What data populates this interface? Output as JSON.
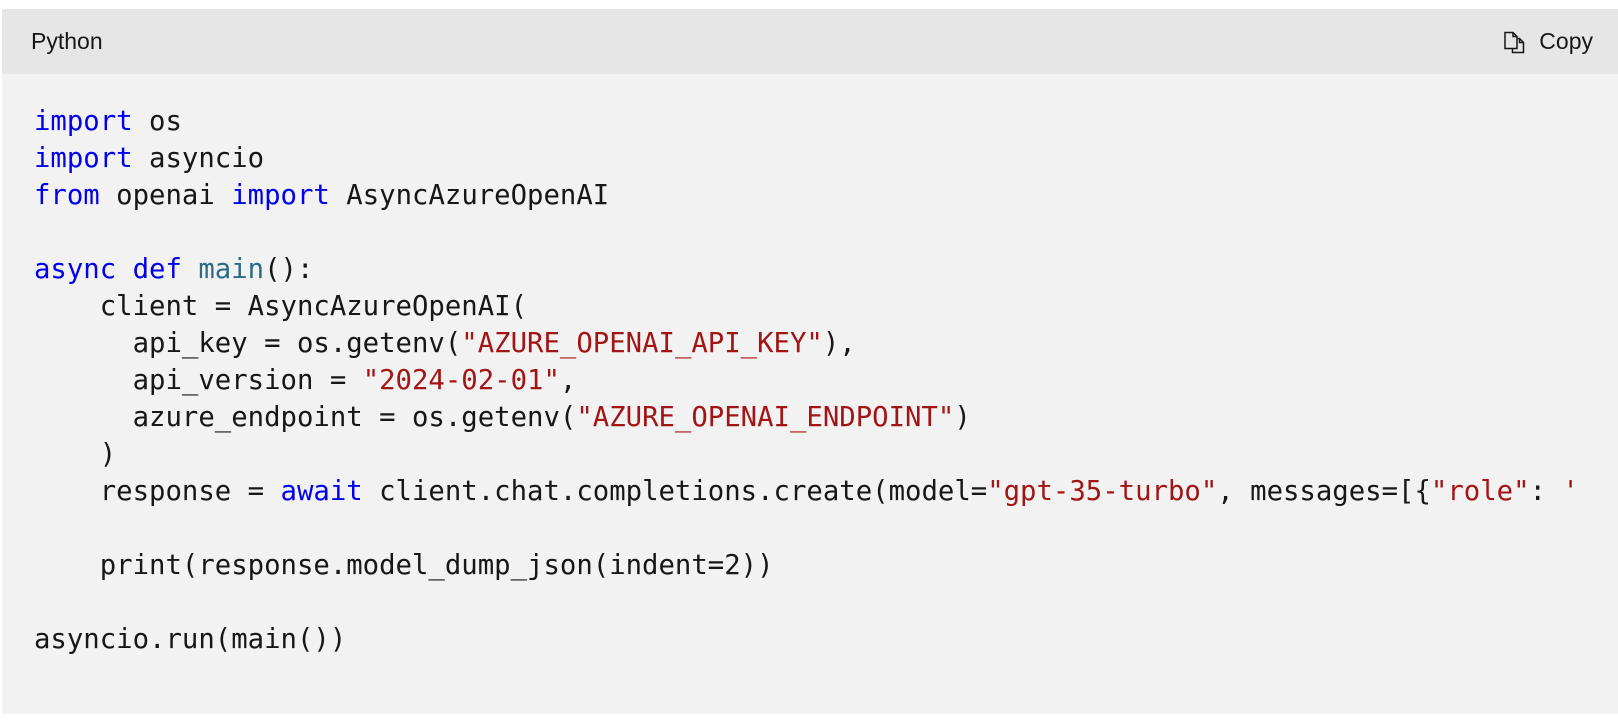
{
  "header": {
    "language": "Python",
    "copy_label": "Copy",
    "copy_icon": "copy-icon"
  },
  "colors": {
    "keyword": "#0000ee",
    "function": "#2c6b85",
    "string": "#a31515",
    "text": "#171717",
    "background": "#f2f2f2",
    "header_background": "#e6e6e6"
  },
  "code": {
    "lines": [
      [
        {
          "t": "kw",
          "v": "import"
        },
        {
          "t": "txt",
          "v": " os"
        }
      ],
      [
        {
          "t": "kw",
          "v": "import"
        },
        {
          "t": "txt",
          "v": " asyncio"
        }
      ],
      [
        {
          "t": "kw",
          "v": "from"
        },
        {
          "t": "txt",
          "v": " openai "
        },
        {
          "t": "kw",
          "v": "import"
        },
        {
          "t": "txt",
          "v": " AsyncAzureOpenAI"
        }
      ],
      [],
      [
        {
          "t": "kw",
          "v": "async"
        },
        {
          "t": "txt",
          "v": " "
        },
        {
          "t": "kw",
          "v": "def"
        },
        {
          "t": "txt",
          "v": " "
        },
        {
          "t": "fn",
          "v": "main"
        },
        {
          "t": "txt",
          "v": "():"
        }
      ],
      [
        {
          "t": "txt",
          "v": "    client = AsyncAzureOpenAI("
        }
      ],
      [
        {
          "t": "txt",
          "v": "      api_key = os.getenv("
        },
        {
          "t": "str",
          "v": "\"AZURE_OPENAI_API_KEY\""
        },
        {
          "t": "txt",
          "v": "),"
        }
      ],
      [
        {
          "t": "txt",
          "v": "      api_version = "
        },
        {
          "t": "str",
          "v": "\"2024-02-01\""
        },
        {
          "t": "txt",
          "v": ","
        }
      ],
      [
        {
          "t": "txt",
          "v": "      azure_endpoint = os.getenv("
        },
        {
          "t": "str",
          "v": "\"AZURE_OPENAI_ENDPOINT\""
        },
        {
          "t": "txt",
          "v": ")"
        }
      ],
      [
        {
          "t": "txt",
          "v": "    )"
        }
      ],
      [
        {
          "t": "txt",
          "v": "    response = "
        },
        {
          "t": "kw",
          "v": "await"
        },
        {
          "t": "txt",
          "v": " client.chat.completions.create(model="
        },
        {
          "t": "str",
          "v": "\"gpt-35-turbo\""
        },
        {
          "t": "txt",
          "v": ", messages=[{"
        },
        {
          "t": "str",
          "v": "\"role\""
        },
        {
          "t": "txt",
          "v": ": "
        },
        {
          "t": "str",
          "v": "'"
        }
      ],
      [],
      [
        {
          "t": "txt",
          "v": "    print(response.model_dump_json(indent=2))"
        }
      ],
      [],
      [
        {
          "t": "txt",
          "v": "asyncio.run(main())"
        }
      ]
    ]
  }
}
